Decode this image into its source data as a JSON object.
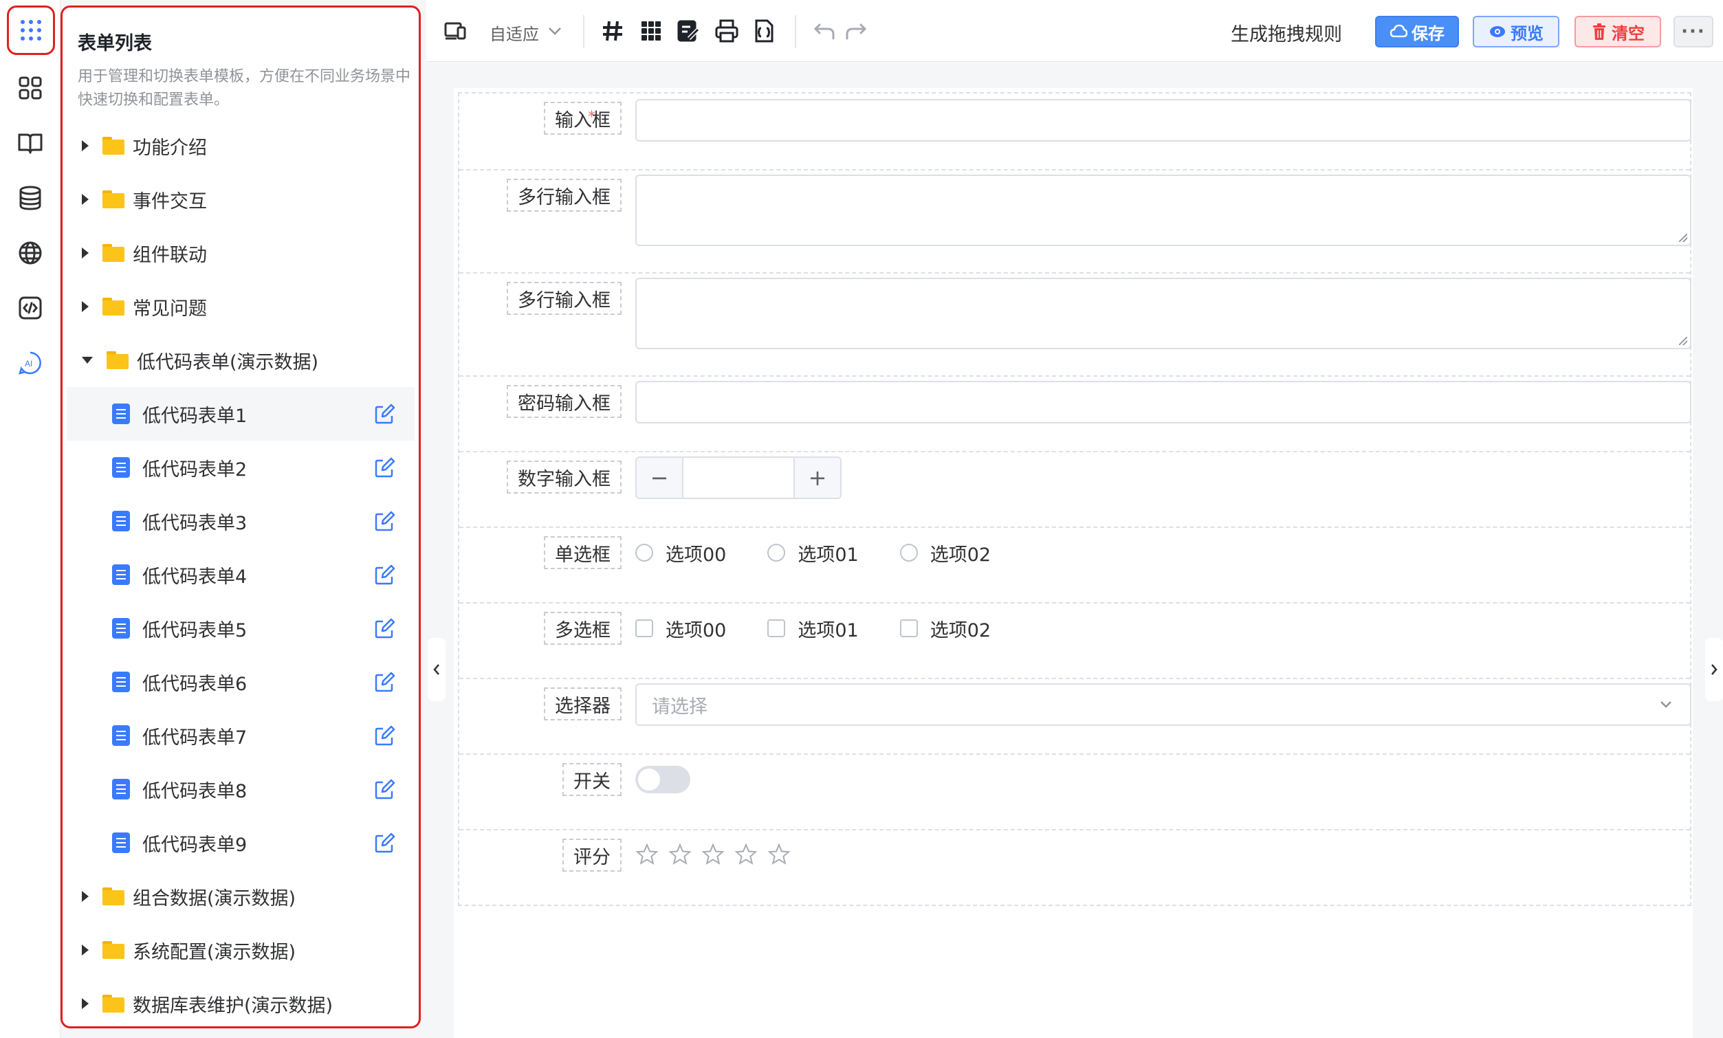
{
  "panel": {
    "title": "表单列表",
    "description": "用于管理和切换表单模板，方便在不同业务场景中快速切换和配置表单。"
  },
  "tree": {
    "folders_top": [
      {
        "label": "功能介绍"
      },
      {
        "label": "事件交互"
      },
      {
        "label": "组件联动"
      },
      {
        "label": "常见问题"
      }
    ],
    "open_folder": {
      "label": "低代码表单(演示数据)",
      "items": [
        {
          "label": "低代码表单1"
        },
        {
          "label": "低代码表单2"
        },
        {
          "label": "低代码表单3"
        },
        {
          "label": "低代码表单4"
        },
        {
          "label": "低代码表单5"
        },
        {
          "label": "低代码表单6"
        },
        {
          "label": "低代码表单7"
        },
        {
          "label": "低代码表单8"
        },
        {
          "label": "低代码表单9"
        }
      ]
    },
    "folders_bottom": [
      {
        "label": "组合数据(演示数据)"
      },
      {
        "label": "系统配置(演示数据)"
      },
      {
        "label": "数据库表维护(演示数据)"
      }
    ]
  },
  "toolbar": {
    "adapt_label": "自适应",
    "generate_label": "生成拖拽规则",
    "save_label": "保存",
    "preview_label": "预览",
    "clear_label": "清空",
    "more_label": "···"
  },
  "form": {
    "input_label": "输入框",
    "textarea1_label": "多行输入框",
    "textarea2_label": "多行输入框",
    "password_label": "密码输入框",
    "number_label": "数字输入框",
    "number_minus": "−",
    "number_plus": "+",
    "radio_label": "单选框",
    "radio_options": [
      "选项00",
      "选项01",
      "选项02"
    ],
    "checkbox_label": "多选框",
    "checkbox_options": [
      "选项00",
      "选项01",
      "选项02"
    ],
    "select_label": "选择器",
    "select_placeholder": "请选择",
    "switch_label": "开关",
    "rate_label": "评分",
    "required_mark": "*"
  },
  "colors": {
    "primary": "#4a8ff7",
    "danger": "#f03e3e",
    "highlight_border": "#e02020",
    "folder": "#fcc419"
  }
}
